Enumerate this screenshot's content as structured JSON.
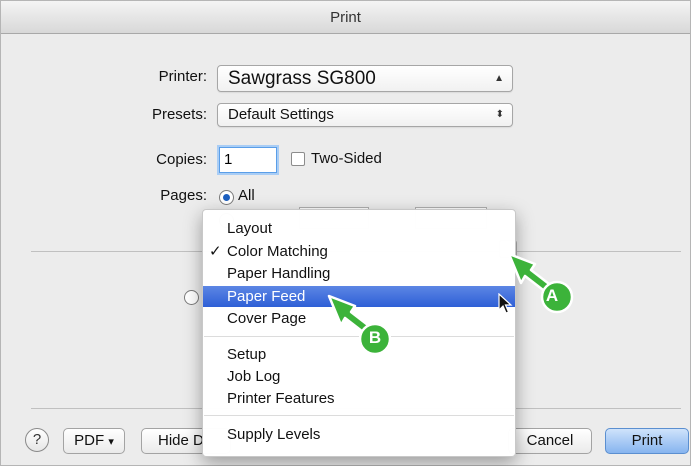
{
  "window": {
    "title": "Print"
  },
  "form": {
    "printer_label": "Printer:",
    "printer_value": "Sawgrass SG800",
    "presets_label": "Presets:",
    "presets_value": "Default Settings",
    "copies_label": "Copies:",
    "copies_value": "1",
    "two_sided_label": "Two-Sided",
    "pages_label": "Pages:",
    "pages_all_label": "All"
  },
  "menu": {
    "items": [
      {
        "label": "Layout",
        "checked": false,
        "highlighted": false
      },
      {
        "label": "Color Matching",
        "checked": true,
        "highlighted": false
      },
      {
        "label": "Paper Handling",
        "checked": false,
        "highlighted": false
      },
      {
        "label": "Paper Feed",
        "checked": false,
        "highlighted": true
      },
      {
        "label": "Cover Page",
        "checked": false,
        "highlighted": false
      }
    ],
    "group2": [
      {
        "label": "Setup"
      },
      {
        "label": "Job Log"
      },
      {
        "label": "Printer Features"
      }
    ],
    "group3": [
      {
        "label": "Supply Levels"
      }
    ],
    "check_mark": "✓"
  },
  "footer": {
    "help": "?",
    "pdf_label": "PDF",
    "pdf_arrow": "▾",
    "hide_label": "Hide D",
    "cancel_label": "Cancel",
    "print_label": "Print"
  },
  "callouts": {
    "a": "A",
    "b": "B"
  },
  "colors": {
    "highlight": "#2e5fd6",
    "callout_green": "#3cb33a",
    "default_button": "#86b4ef"
  }
}
